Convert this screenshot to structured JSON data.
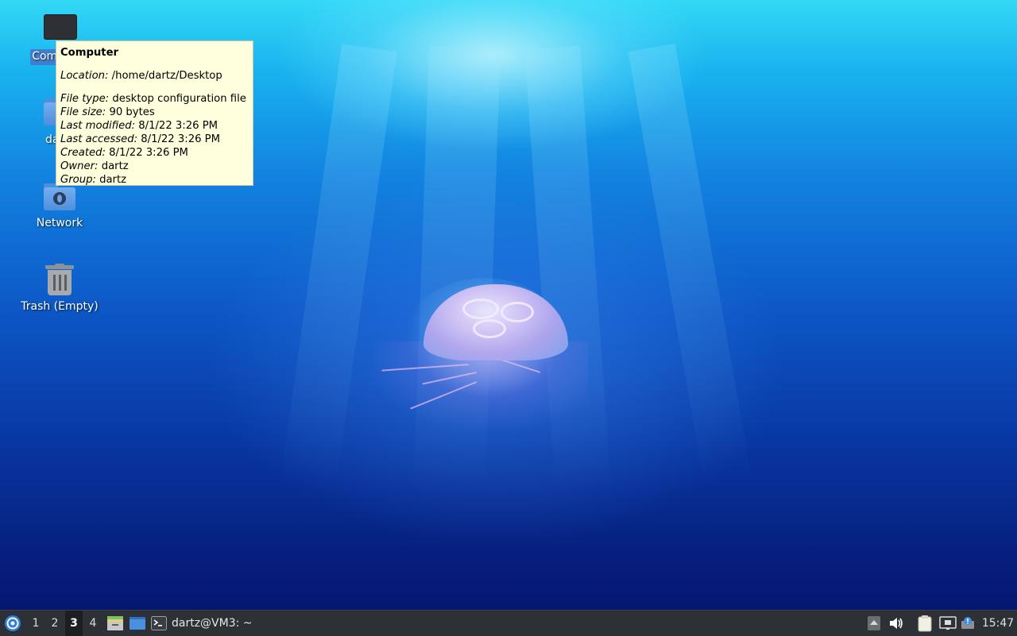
{
  "desktop": {
    "icons": [
      {
        "label": "Computer"
      },
      {
        "label": "dartz"
      },
      {
        "label": "Network"
      },
      {
        "label": "Trash (Empty)"
      }
    ]
  },
  "tooltip": {
    "title": "Computer",
    "location_key": "Location:",
    "location_value": "/home/dartz/Desktop",
    "rows": [
      {
        "key": "File type:",
        "value": "desktop configuration file"
      },
      {
        "key": "File size:",
        "value": "90 bytes"
      },
      {
        "key": "Last modified:",
        "value": "8/1/22 3:26 PM"
      },
      {
        "key": "Last accessed:",
        "value": "8/1/22 3:26 PM"
      },
      {
        "key": "Created:",
        "value": "8/1/22 3:26 PM"
      },
      {
        "key": "Owner:",
        "value": "dartz"
      },
      {
        "key": "Group:",
        "value": "dartz"
      }
    ]
  },
  "taskbar": {
    "workspaces": [
      "1",
      "2",
      "3",
      "4"
    ],
    "active_workspace": "3",
    "task_label": "dartz@VM3: ~",
    "clock": "15:47"
  },
  "colors": {
    "taskbar_bg": "#2d3035",
    "tooltip_bg": "#ffffde",
    "folder_blue": "#5b9be6"
  }
}
